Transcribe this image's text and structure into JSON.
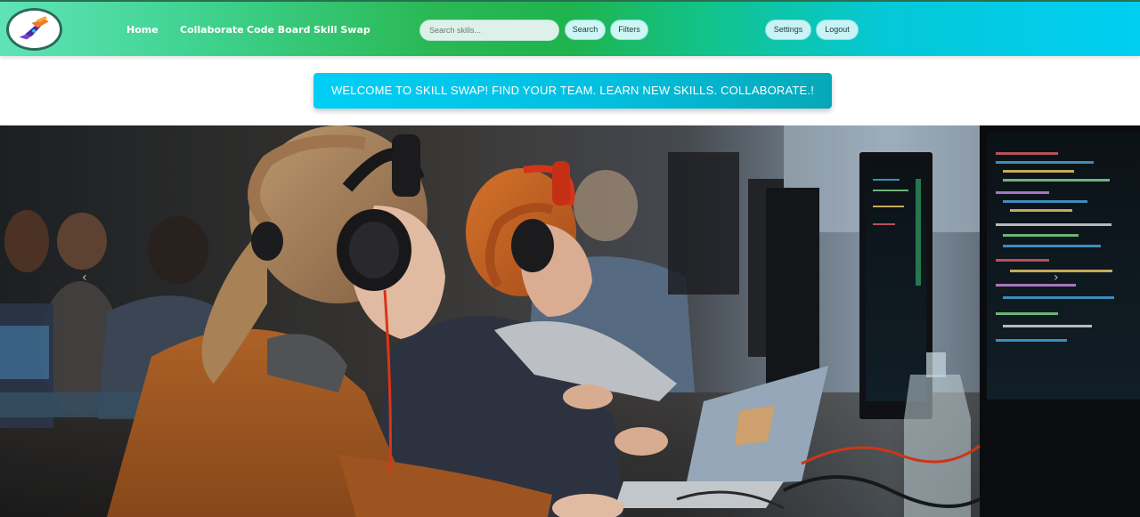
{
  "nav": {
    "logo_icon": "hand-shake-logo-icon",
    "links": [
      "Home",
      "Collaborate",
      "Code Board",
      "Skill Swap"
    ],
    "search": {
      "placeholder": "Search skills..."
    },
    "search_button": "Search",
    "filters_button": "Filters",
    "settings_button": "Settings",
    "logout_button": "Logout"
  },
  "banner": {
    "text": "WELCOME TO SKILL SWAP! FIND YOUR TEAM. LEARN NEW SKILLS. COLLABORATE.!"
  },
  "hero": {
    "prev_icon": "chevron-left-icon",
    "next_icon": "chevron-right-icon",
    "prev_glyph": "‹",
    "next_glyph": "›"
  },
  "colors": {
    "nav_gradient_start": "#5fe3b8",
    "nav_gradient_mid": "#1fb34d",
    "nav_gradient_end": "#00cff2",
    "banner": "#00cff5",
    "button_bg": "#cdf6f4"
  }
}
